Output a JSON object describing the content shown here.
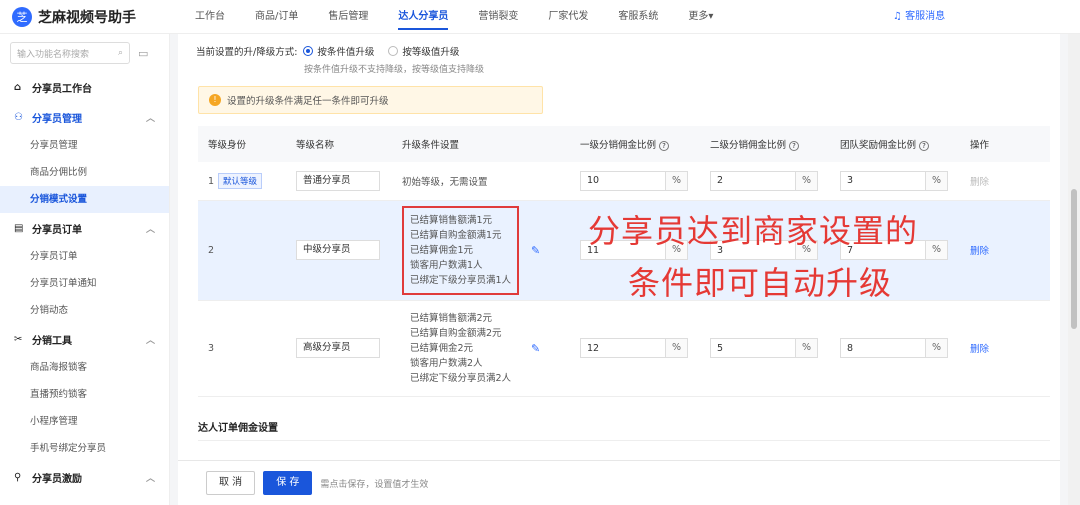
{
  "brand": {
    "name": "芝麻视频号助手",
    "logo_icon": "sesame-logo-icon"
  },
  "top_nav": [
    {
      "label": "工作台",
      "active": false
    },
    {
      "label": "商品/订单",
      "active": false
    },
    {
      "label": "售后管理",
      "active": false
    },
    {
      "label": "达人分享员",
      "active": true
    },
    {
      "label": "营销裂变",
      "active": false
    },
    {
      "label": "厂家代发",
      "active": false
    },
    {
      "label": "客服系统",
      "active": false
    },
    {
      "label": "更多▾",
      "active": false
    }
  ],
  "service_msg": "客服消息",
  "sidebar": {
    "search_placeholder": "输入功能名称搜索",
    "groups": [
      {
        "icon": "⌂",
        "label": "分享员工作台",
        "chevron": "",
        "items": []
      },
      {
        "icon": "⚇",
        "label": "分享员管理",
        "chevron": "︿",
        "active": true,
        "items": [
          "分享员管理",
          "商品分佣比例",
          "分销模式设置"
        ]
      },
      {
        "icon": "▤",
        "label": "分享员订单",
        "chevron": "︿",
        "items": [
          "分享员订单",
          "分享员订单通知",
          "分销动态"
        ]
      },
      {
        "icon": "✂",
        "label": "分销工具",
        "chevron": "︿",
        "items": [
          "商品海报锁客",
          "直播预约锁客",
          "小程序管理",
          "手机号绑定分享员"
        ]
      },
      {
        "icon": "⚲",
        "label": "分享员激励",
        "chevron": "︿",
        "items": []
      }
    ],
    "active_item": "分销模式设置"
  },
  "mode": {
    "label": "当前设置的升/降级方式:",
    "options": [
      "按条件值升级",
      "按等级值升级"
    ],
    "selected": "按条件值升级",
    "tip": "按条件值升级不支持降级，按等级值支持降级"
  },
  "notice": "设置的升级条件满足任一条件即可升级",
  "table": {
    "headers": [
      "等级身份",
      "等级名称",
      "升级条件设置",
      "一级分销佣金比例",
      "二级分销佣金比例",
      "团队奖励佣金比例",
      "操作"
    ],
    "rows": [
      {
        "level": "1",
        "tag": "默认等级",
        "name": "普通分享员",
        "conditions": [
          "初始等级，无需设置"
        ],
        "c1": "10",
        "c2": "2",
        "c3": "3",
        "op": "删除",
        "op_disabled": true
      },
      {
        "level": "2",
        "tag": "",
        "name": "中级分享员",
        "conditions": [
          "已结算销售额满1元",
          "已结算自购金额满1元",
          "已结算佣金1元",
          "锁客用户数满1人",
          "已绑定下级分享员满1人"
        ],
        "c1": "11",
        "c2": "3",
        "c3": "7",
        "op": "删除",
        "op_disabled": false,
        "highlight": true
      },
      {
        "level": "3",
        "tag": "",
        "name": "高级分享员",
        "conditions": [
          "已结算销售额满2元",
          "已结算自购金额满2元",
          "已结算佣金2元",
          "锁客用户数满2人",
          "已绑定下级分享员满2人"
        ],
        "c1": "12",
        "c2": "5",
        "c3": "8",
        "op": "删除",
        "op_disabled": false
      }
    ],
    "unit": "%"
  },
  "overlay": {
    "line1": "分享员达到商家设置的",
    "line2": "条件即可自动升级"
  },
  "section_title": "达人订单佣金设置",
  "footer": {
    "cancel": "取 消",
    "save": "保 存",
    "tip": "需点击保存，设置值才生效"
  },
  "colors": {
    "accent": "#1a56db",
    "annotation": "#e53935"
  }
}
